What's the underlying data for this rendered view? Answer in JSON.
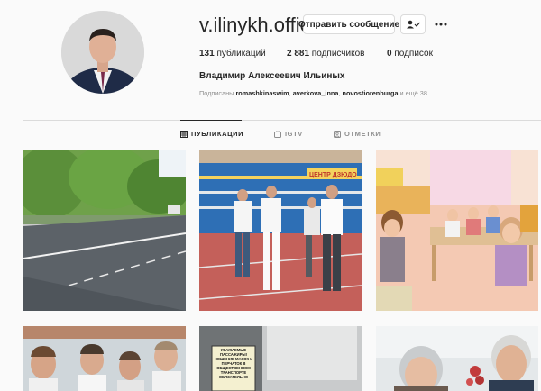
{
  "profile": {
    "username": "v.ilinykh.official",
    "message_button": "Отправить сообщение",
    "full_name": "Владимир Алексеевич Ильиных"
  },
  "stats": {
    "posts_count": "131",
    "posts_label": " публикаций",
    "followers_count": "2 881",
    "followers_label": " подписчиков",
    "following_count": "0",
    "following_label": " подписок"
  },
  "followed_by": {
    "prefix": "Подписаны ",
    "user1": "romashkinaswim",
    "sep1": ", ",
    "user2": "averkova_inna",
    "sep2": ", ",
    "user3": "novostiorenburga",
    "suffix": " и ещё 38"
  },
  "tabs": [
    {
      "label": "ПУБЛИКАЦИИ",
      "icon": "grid-icon",
      "active": true
    },
    {
      "label": "IGTV",
      "icon": "igtv-icon",
      "active": false
    },
    {
      "label": "ОТМЕТКИ",
      "icon": "tagged-icon",
      "active": false
    }
  ],
  "posts": [
    {
      "scene": "road-street"
    },
    {
      "scene": "officials-walking-building"
    },
    {
      "scene": "kindergarten-children"
    },
    {
      "scene": "men-group"
    },
    {
      "scene": "bus-stop-sign"
    },
    {
      "scene": "elderly-couple"
    }
  ],
  "bus_sign_text": "УВАЖАЕМЫЕ ПАССАЖИРЫ! НОШЕНИЕ МАСОК И ПЕРЧАТОК В ОБЩЕСТВЕННОМ ТРАНСПОРТЕ ОБЯЗАТЕЛЬНО",
  "building_sign": "ЦЕНТР ДЗЮДО",
  "colors": {
    "background": "#fafafa",
    "text": "#262626",
    "secondary": "#8e8e8e",
    "border": "#dbdbdb"
  }
}
